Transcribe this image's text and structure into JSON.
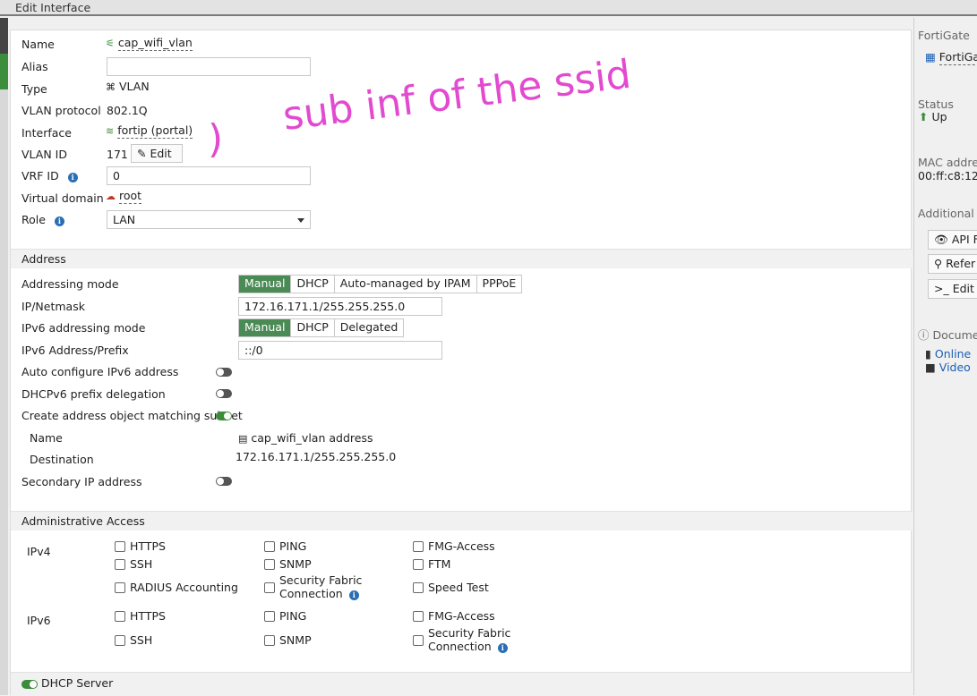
{
  "window": {
    "title": "Edit Interface"
  },
  "form": {
    "name_label": "Name",
    "name_value": "cap_wifi_vlan",
    "alias_label": "Alias",
    "alias_value": "",
    "type_label": "Type",
    "type_value": "VLAN",
    "vlan_protocol_label": "VLAN protocol",
    "vlan_protocol_value": "802.1Q",
    "interface_label": "Interface",
    "interface_value": "fortip (portal)",
    "vlan_id_label": "VLAN ID",
    "vlan_id_value": "171",
    "vlan_edit_label": "Edit",
    "vrf_id_label": "VRF ID",
    "vrf_id_value": "0",
    "virtual_domain_label": "Virtual domain",
    "virtual_domain_value": "root",
    "role_label": "Role",
    "role_value": "LAN"
  },
  "address": {
    "section_title": "Address",
    "addressing_mode_label": "Addressing mode",
    "addressing_modes": [
      "Manual",
      "DHCP",
      "Auto-managed by IPAM",
      "PPPoE"
    ],
    "ip_netmask_label": "IP/Netmask",
    "ip_netmask_value": "172.16.171.1/255.255.255.0",
    "ipv6_mode_label": "IPv6 addressing mode",
    "ipv6_modes": [
      "Manual",
      "DHCP",
      "Delegated"
    ],
    "ipv6_prefix_label": "IPv6 Address/Prefix",
    "ipv6_prefix_value": "::/0",
    "auto_ipv6_label": "Auto configure IPv6 address",
    "dhcpv6_label": "DHCPv6 prefix delegation",
    "create_obj_label": "Create address object matching subnet",
    "obj_name_label": "Name",
    "obj_name_value": "cap_wifi_vlan address",
    "obj_dest_label": "Destination",
    "obj_dest_value": "172.16.171.1/255.255.255.0",
    "secondary_ip_label": "Secondary IP address"
  },
  "admin_access": {
    "section_title": "Administrative Access",
    "ipv4_label": "IPv4",
    "ipv6_label": "IPv6",
    "ipv4_items": [
      "HTTPS",
      "PING",
      "FMG-Access",
      "SSH",
      "SNMP",
      "FTM",
      "RADIUS Accounting",
      "Security Fabric",
      "Connection",
      "Speed Test"
    ],
    "ipv6_items": [
      "HTTPS",
      "PING",
      "FMG-Access",
      "SSH",
      "SNMP",
      "Security Fabric",
      "Connection"
    ]
  },
  "dhcp": {
    "title": "DHCP Server"
  },
  "right_panel": {
    "device_label": "FortiGate",
    "device_name": "FortiGa",
    "status_label": "Status",
    "status_value": "Up",
    "mac_label": "MAC addres",
    "mac_value": "00:ff:c8:12:9",
    "additional_label": "Additional Ir",
    "api_btn": "API F",
    "refs_btn": "Refer",
    "edit_btn": "Edit i",
    "docs_label": "Docume",
    "online_label": "Online",
    "video_label": "Video"
  },
  "annotation": {
    "handwriting": "sub inf of the ssid",
    "color": "#e24ad0"
  }
}
